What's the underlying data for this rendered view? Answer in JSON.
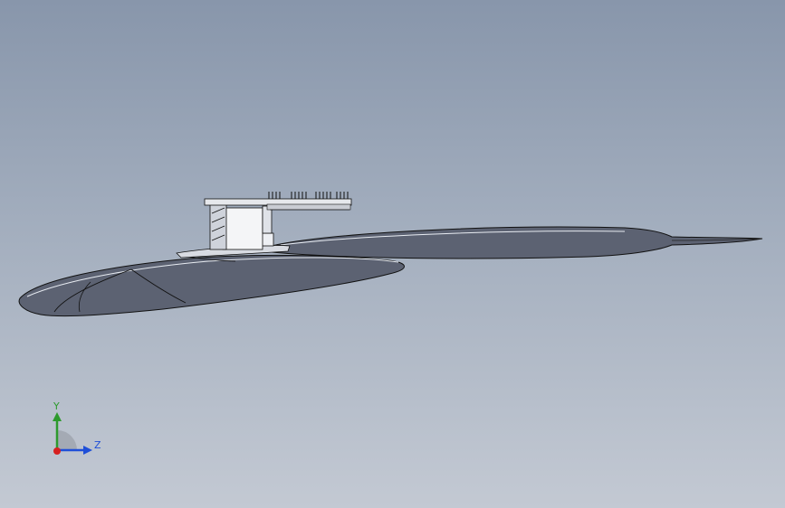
{
  "viewport": {
    "background_top": "#8896ab",
    "background_bottom": "#c3c9d3",
    "part_fill": "#5c6272",
    "edge_color": "#1a1a1a",
    "highlight_color": "#ffffff"
  },
  "triad": {
    "y_label": "Y",
    "z_label": "Z",
    "y_color": "#2d9a2d",
    "z_color": "#1f4fd8",
    "x_color": "#d62020"
  }
}
